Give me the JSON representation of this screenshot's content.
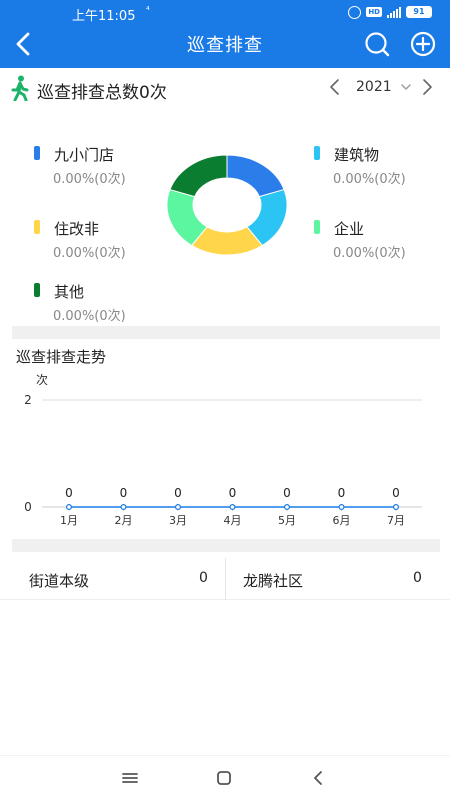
{
  "status_bar": {
    "time": "上午11:05",
    "extra": "⁴",
    "hd": "HD",
    "battery": "91"
  },
  "nav": {
    "back_icon": "chevron-left-icon",
    "title": "巡查排查",
    "search_icon": "search-icon",
    "add_icon": "plus-circle-icon"
  },
  "summary": {
    "title": "巡查排查总数0次",
    "year": "2021"
  },
  "donut_legend": [
    {
      "name": "九小门店",
      "value": "0.00%(0次)",
      "color": "#2b7de9"
    },
    {
      "name": "建筑物",
      "value": "0.00%(0次)",
      "color": "#2cc4f2"
    },
    {
      "name": "住改非",
      "value": "0.00%(0次)",
      "color": "#ffd54a"
    },
    {
      "name": "企业",
      "value": "0.00%(0次)",
      "color": "#5cf5a0"
    },
    {
      "name": "其他",
      "value": "0.00%(0次)",
      "color": "#0b7d31"
    }
  ],
  "chart_data": {
    "type": "line",
    "title": "巡查排查走势",
    "ylabel": "次",
    "categories": [
      "1月",
      "2月",
      "3月",
      "4月",
      "5月",
      "6月",
      "7月"
    ],
    "values": [
      0,
      0,
      0,
      0,
      0,
      0,
      0
    ],
    "data_labels": [
      "0",
      "0",
      "0",
      "0",
      "0",
      "0",
      "0"
    ],
    "y_ticks": [
      "2",
      "0"
    ],
    "ylim": [
      0,
      2
    ],
    "line_color": "#1b7be6",
    "grid": true
  },
  "areas": [
    {
      "name": "街道本级",
      "count": "0"
    },
    {
      "name": "龙腾社区",
      "count": "0"
    }
  ],
  "bottom_nav": {
    "menu_icon": "menu-icon",
    "home_icon": "home-icon",
    "back_icon": "back-icon"
  }
}
